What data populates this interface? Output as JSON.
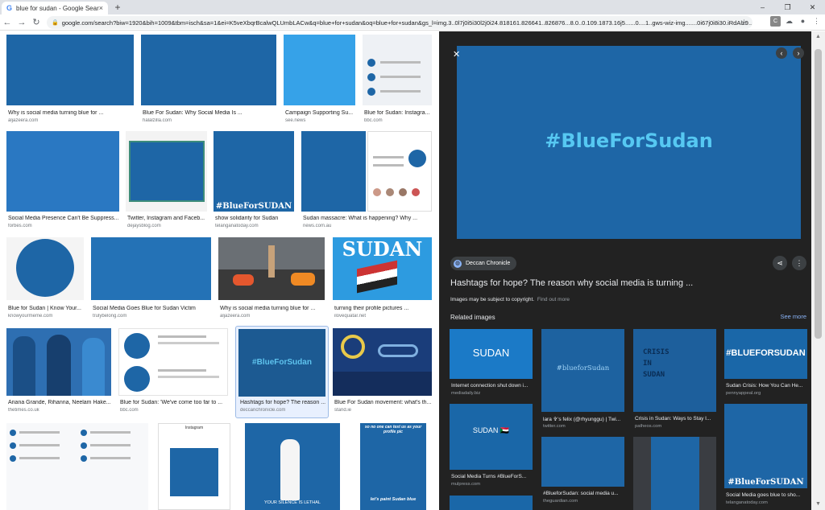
{
  "browser": {
    "tab_title": "blue for sudan - Google Search",
    "tab_favicon": "G",
    "tab_close": "×",
    "new_tab": "+",
    "url": "google.com/search?biw=1920&bih=1009&tbm=isch&sa=1&ei=K5veXbqrBcalwQLUmbLACw&q=blue+for+sudan&oq=blue+for+sudan&gs_l=img.3..0l7j0i5i30l2j0i24.818161.826641..826876...8.0..0.109.1873.16j5......0....1..gws-wiz-img.......0i67j0i8i30.iRdAlz9...",
    "window_controls": [
      "–",
      "❐",
      "✕"
    ],
    "ext_icons": [
      "C",
      "☁"
    ]
  },
  "grid": {
    "items": [
      {
        "caption": "Why is social media turning blue for ...",
        "source": "aljazeera.com"
      },
      {
        "caption": "Blue For Sudan: Why Social Media Is ...",
        "source": "halalzilla.com"
      },
      {
        "caption": "Campaign Supporting Su...",
        "source": "see.news"
      },
      {
        "caption": "Blue for Sudan: Instagra...",
        "source": "bbc.com"
      },
      {
        "caption": "Social Media Presence Can't Be Suppress...",
        "source": "forbes.com"
      },
      {
        "caption": "Twitter, Instagram and Faceb...",
        "source": "dejaysblog.com"
      },
      {
        "caption": "show solidarity for Sudan",
        "source": "telanganatoday.com",
        "overlay": "#BlueForSUDAN"
      },
      {
        "caption": "Sudan massacre: What is happening? Why ...",
        "source": "news.com.au"
      },
      {
        "caption": "Blue for Sudan | Know Your...",
        "source": "knowyourmeme.com"
      },
      {
        "caption": "Social Media Goes Blue for Sudan Victim",
        "source": "trulybelong.com"
      },
      {
        "caption": "Why is social media turning blue for ...",
        "source": "aljazeera.com"
      },
      {
        "caption": "turning their profile pictures ...",
        "source": "ilovequatar.net",
        "overlay": "SUDAN"
      },
      {
        "caption": "Ariana Grande, Rihanna, Neelam Hake...",
        "source": "thetimes.co.uk"
      },
      {
        "caption": "Blue for Sudan: 'We've come too far to ...",
        "source": "bbc.com"
      },
      {
        "caption": "Hashtags for hope? The reason ...",
        "source": "deccanchronicle.com",
        "overlay": "#BlueForSudan"
      },
      {
        "caption": "Blue For Sudan movement: what's th...",
        "source": "stand.ie"
      },
      {
        "caption": "",
        "source": ""
      },
      {
        "caption": "",
        "source": "",
        "overlay": "Instagram"
      },
      {
        "caption": "",
        "source": "",
        "overlay": "YOUR SILENCE IS LETHAL"
      },
      {
        "caption": "",
        "source": "",
        "overlay": "let's paint Sudan blue",
        "overlay_top": "so no one can test us as your profile pic"
      }
    ]
  },
  "panel": {
    "close": "✕",
    "prev": "‹",
    "next": "›",
    "preview_text": "#BlueForSudan",
    "source_chip": "Deccan Chronicle",
    "title": "Hashtags for hope? The reason why social media is turning ...",
    "copyright": "Images may be subject to copyright.",
    "find_out_more": "Find out more",
    "related_label": "Related images",
    "see_more": "See more",
    "related": [
      {
        "caption": "Internet connection shut down i...",
        "source": "mediadaily.biz",
        "overlay": "SUDAN"
      },
      {
        "caption": "lara ✞'s felix (@rhyunggu) | Twi...",
        "source": "twitter.com",
        "overlay": "#blueforSudan"
      },
      {
        "caption": "Crisis in Sudan: Ways to Stay I...",
        "source": "patheos.com",
        "overlay": "CRISIS IN SUDAN"
      },
      {
        "caption": "Sudan Crisis: How You Can He...",
        "source": "pennyappeal.org",
        "overlay": "#BLUEFORSUDAN"
      },
      {
        "caption": "Social Media Turns #BlueForS...",
        "source": "mulpress.com",
        "overlay": "SUDAN 🇸🇩"
      },
      {
        "caption": "#BlueforSudan: social media u...",
        "source": "theguardian.com"
      },
      {
        "caption": "",
        "source": ""
      },
      {
        "caption": "Social Media goes blue to sho...",
        "source": "telanganatoday.com",
        "overlay": "#BlueForSUDAN"
      }
    ]
  }
}
